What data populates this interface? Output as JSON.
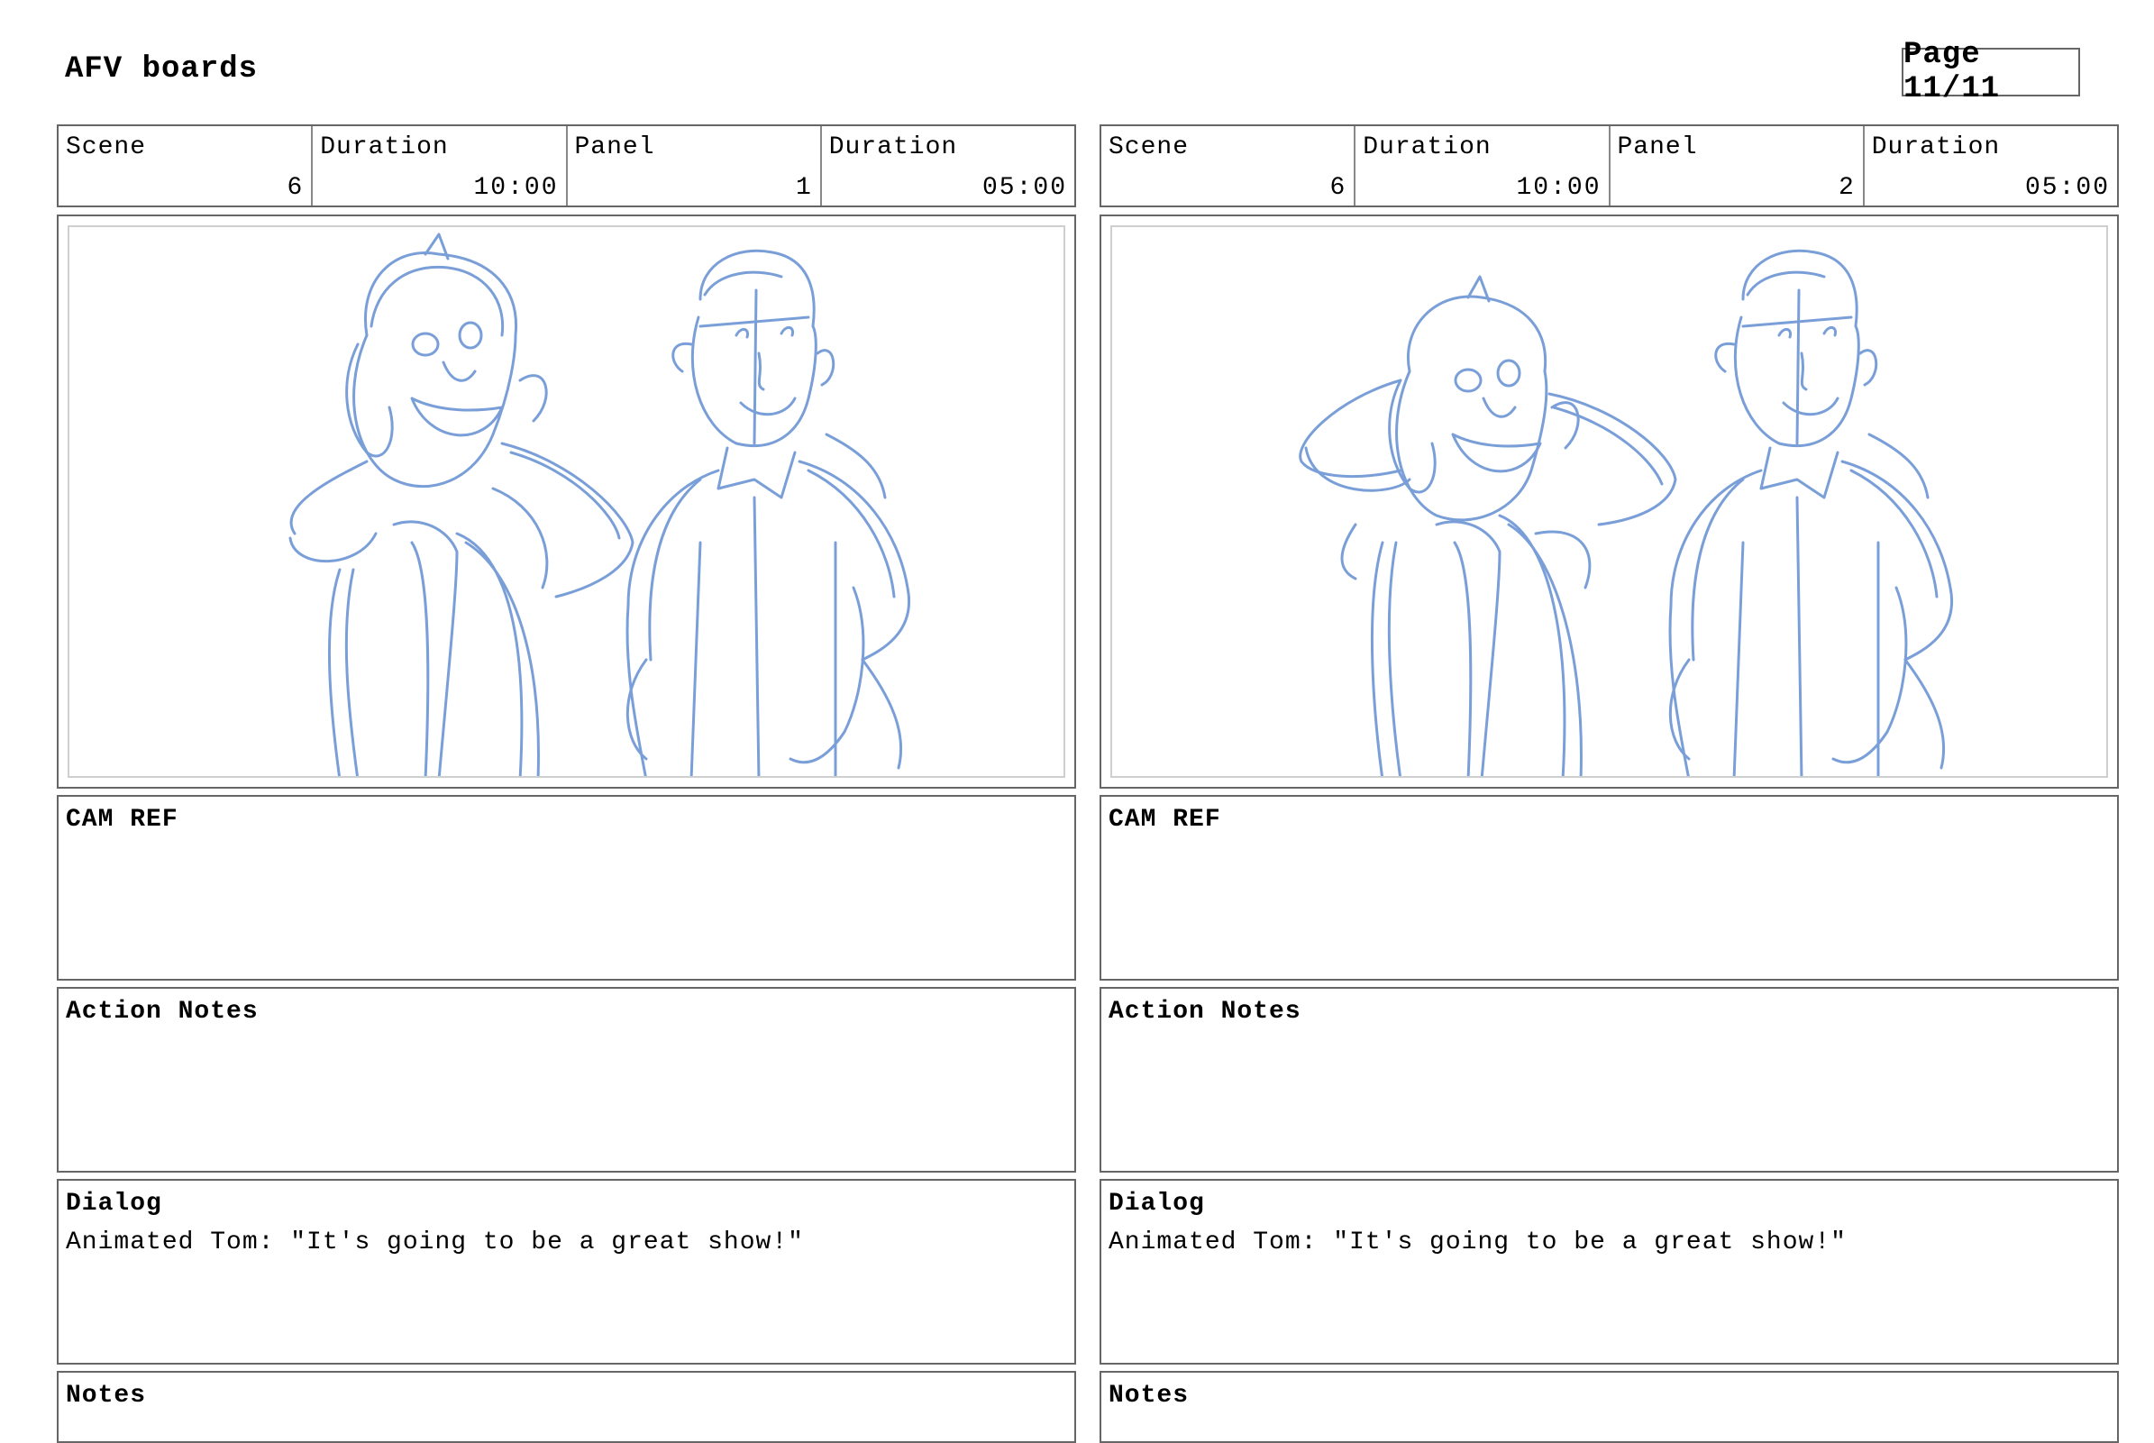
{
  "document": {
    "title": "AFV boards",
    "page": "Page 11/11"
  },
  "colors": {
    "sketch": "#7a9fd8",
    "border": "#666666",
    "inner_border": "#cfcfcf"
  },
  "panels": [
    {
      "scene_label": "Scene",
      "scene": "6",
      "scene_duration_label": "Duration",
      "scene_duration": "10:00",
      "panel_label": "Panel",
      "panel": "1",
      "panel_duration_label": "Duration",
      "panel_duration": "05:00",
      "image": "storyboard-sketch-two-men",
      "cam_ref_label": "CAM REF",
      "cam_ref": "",
      "action_notes_label": "Action Notes",
      "action_notes": "",
      "dialog_label": "Dialog",
      "dialog": "Animated Tom: \"It's going to be a great show!\"",
      "notes_label": "Notes",
      "notes": ""
    },
    {
      "scene_label": "Scene",
      "scene": "6",
      "scene_duration_label": "Duration",
      "scene_duration": "10:00",
      "panel_label": "Panel",
      "panel": "2",
      "panel_duration_label": "Duration",
      "panel_duration": "05:00",
      "image": "storyboard-sketch-two-men",
      "cam_ref_label": "CAM REF",
      "cam_ref": "",
      "action_notes_label": "Action Notes",
      "action_notes": "",
      "dialog_label": "Dialog",
      "dialog": "Animated Tom: \"It's going to be a great show!\"",
      "notes_label": "Notes",
      "notes": ""
    }
  ]
}
